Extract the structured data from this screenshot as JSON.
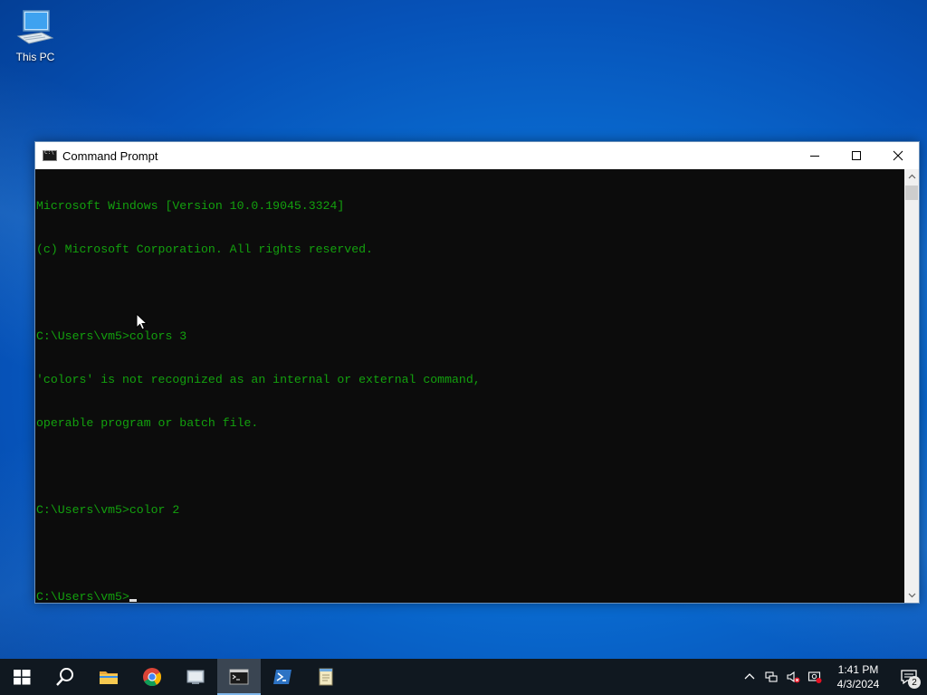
{
  "desktop": {
    "icons": [
      {
        "label": "This PC",
        "icon": "computer-icon"
      }
    ]
  },
  "window": {
    "title": "Command Prompt",
    "controls": [
      "minimize-icon",
      "maximize-icon",
      "close-icon"
    ]
  },
  "console": {
    "text_color": "#13a10e",
    "background": "#0c0c0c",
    "lines": [
      "Microsoft Windows [Version 10.0.19045.3324]",
      "(c) Microsoft Corporation. All rights reserved.",
      "",
      "C:\\Users\\vm5>colors 3",
      "'colors' is not recognized as an internal or external command,",
      "operable program or batch file.",
      "",
      "C:\\Users\\vm5>color 2",
      "",
      "C:\\Users\\vm5>"
    ]
  },
  "taskbar": {
    "items": [
      {
        "name": "start",
        "icon": "windows-logo-icon"
      },
      {
        "name": "search",
        "icon": "search-icon"
      },
      {
        "name": "file-explorer",
        "icon": "folder-icon"
      },
      {
        "name": "chrome",
        "icon": "chrome-icon"
      },
      {
        "name": "app",
        "icon": "app-icon"
      },
      {
        "name": "command-prompt",
        "icon": "cmd-icon",
        "active": true
      },
      {
        "name": "powershell",
        "icon": "powershell-icon"
      },
      {
        "name": "notepad",
        "icon": "notepad-icon"
      }
    ],
    "tray": {
      "icons": [
        "chevron-up-icon",
        "network-icon",
        "volume-muted-icon",
        "security-icon"
      ],
      "time": "1:41 PM",
      "date": "4/3/2024",
      "notification_count": "2"
    }
  }
}
